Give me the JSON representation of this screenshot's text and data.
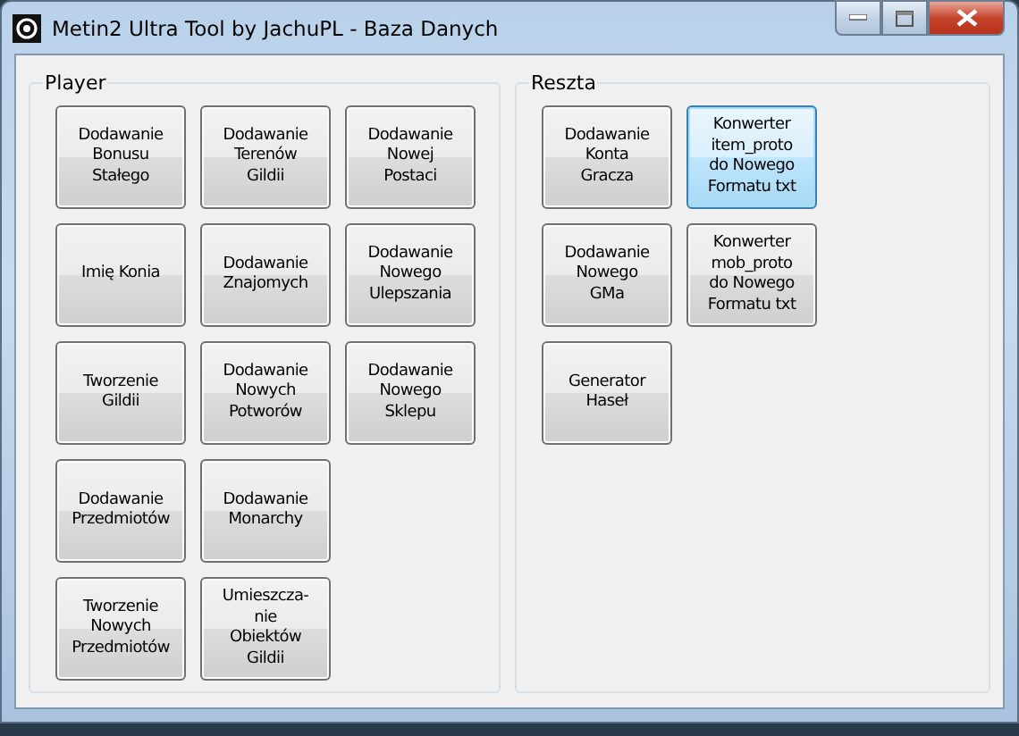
{
  "window": {
    "title": "Metin2 Ultra Tool by JachuPL - Baza Danych"
  },
  "groups": [
    {
      "title": "Player",
      "rows": [
        [
          {
            "label": "Dodawanie\nBonusu\nStałego",
            "focused": false
          },
          {
            "label": "Dodawanie\nTerenów\nGildii",
            "focused": false
          },
          {
            "label": "Dodawanie\nNowej\nPostaci",
            "focused": false
          }
        ],
        [
          {
            "label": "Imię Konia",
            "focused": false
          },
          {
            "label": "Dodawanie\nZnajomych",
            "focused": false
          },
          {
            "label": "Dodawanie\nNowego\nUlepszania",
            "focused": false
          }
        ],
        [
          {
            "label": "Tworzenie\nGildii",
            "focused": false
          },
          {
            "label": "Dodawanie\nNowych\nPotworów",
            "focused": false
          },
          {
            "label": "Dodawanie\nNowego\nSklepu",
            "focused": false
          }
        ],
        [
          {
            "label": "Dodawanie\nPrzedmiotów",
            "focused": false
          },
          {
            "label": "Dodawanie\nMonarchy",
            "focused": false
          }
        ],
        [
          {
            "label": "Tworzenie\nNowych\nPrzedmiotów",
            "focused": false
          },
          {
            "label": "Umieszcza-\nnie\nObiektów\nGildii",
            "focused": false
          }
        ]
      ]
    },
    {
      "title": "Reszta",
      "rows": [
        [
          {
            "label": "Dodawanie\nKonta\nGracza",
            "focused": false
          },
          {
            "label": "Konwerter\nitem_proto\ndo Nowego\nFormatu txt",
            "focused": true
          }
        ],
        [
          {
            "label": "Dodawanie\nNowego\nGMa",
            "focused": false
          },
          {
            "label": "Konwerter\nmob_proto\ndo Nowego\nFormatu txt",
            "focused": false
          }
        ],
        [
          {
            "label": "Generator\nHaseł",
            "focused": false
          }
        ]
      ]
    }
  ]
}
